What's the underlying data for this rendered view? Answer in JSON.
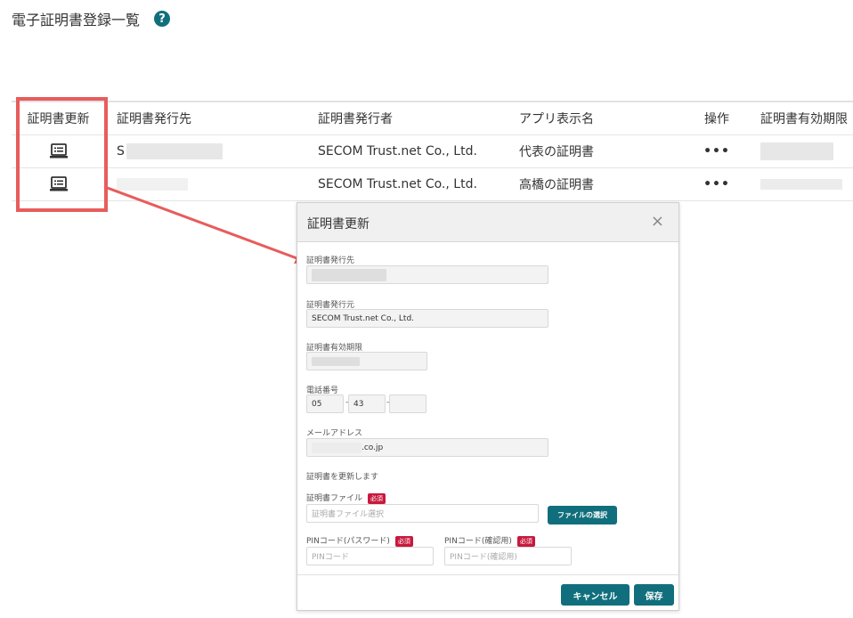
{
  "page": {
    "title": "電子証明書登録一覧",
    "help_icon": "?"
  },
  "table": {
    "headers": [
      "証明書更新",
      "証明書発行先",
      "証明書発行者",
      "アプリ表示名",
      "操作",
      "証明書有効期限"
    ],
    "rows": [
      {
        "issued_to": "S",
        "issuer": "SECOM Trust.net Co., Ltd.",
        "app_name": "代表の証明書",
        "action": "•••"
      },
      {
        "issued_to": "",
        "issuer": "SECOM Trust.net Co., Ltd.",
        "app_name": "高橋の証明書",
        "action": "•••"
      }
    ]
  },
  "modal": {
    "title": "証明書更新",
    "close": "×",
    "issued_to_label": "証明書発行先",
    "issuer_label": "証明書発行元",
    "issuer_value": "SECOM Trust.net Co., Ltd.",
    "expiry_label": "証明書有効期限",
    "phone_label": "電話番号",
    "phone_part1": "05",
    "phone_part2": "43",
    "phone_sep": "-",
    "email_label": "メールアドレス",
    "email_value": ".co.jp",
    "update_note": "証明書を更新します",
    "file_label": "証明書ファイル",
    "required": "必須",
    "file_placeholder": "証明書ファイル選択",
    "file_button": "ファイルの選択",
    "pin_label": "PINコード(パスワード)",
    "pin_placeholder": "PINコード",
    "pin_confirm_label": "PINコード(確認用)",
    "pin_confirm_placeholder": "PINコード(確認用)",
    "cancel": "キャンセル",
    "save": "保存"
  },
  "colors": {
    "accent": "#116f7d",
    "highlight": "#e85c5c",
    "required": "#c8193c"
  }
}
